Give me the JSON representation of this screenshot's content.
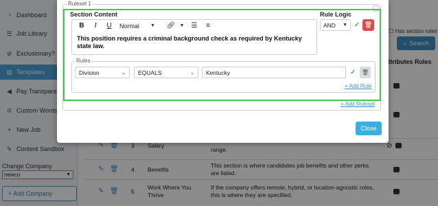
{
  "sidebar": {
    "items": [
      {
        "label": "Dashboard",
        "icon": "speedometer-icon"
      },
      {
        "label": "Job Library",
        "icon": "list-icon"
      },
      {
        "label": "Exclusionary?",
        "icon": "ban-icon"
      },
      {
        "label": "Templates",
        "icon": "document-icon"
      },
      {
        "label": "Pay Transparen",
        "icon": "megaphone-icon"
      },
      {
        "label": "Custom Words",
        "icon": "trophy-icon"
      },
      {
        "label": "New Job",
        "icon": "plus-icon"
      },
      {
        "label": "Content Sandbox",
        "icon": "pencil-icon"
      }
    ],
    "change_company_label": "Change Company",
    "company_value": "newco",
    "add_company_label": "+ Add Company"
  },
  "background": {
    "has_rules_label": "Has section rules",
    "search_label": "Search",
    "columns": [
      "Attributes",
      "Rules"
    ],
    "rows": [
      {
        "num": "3",
        "name": "Salary",
        "content": "range."
      },
      {
        "num": "4",
        "name": "Benefits",
        "content": "This section is where candidates job benefits and other perks are listed."
      },
      {
        "num": "5",
        "name": "Work Where You Thrive",
        "content": "If the company offers remote, hybrid, or location-agnostic roles, this is where they are specified."
      }
    ]
  },
  "modal": {
    "ruleset_label": "Ruleset 1",
    "section_content_title": "Section Content",
    "rule_logic_title": "Rule Logic",
    "toolbar": {
      "bold": "B",
      "italic": "I",
      "underline": "U",
      "format_value": "Normal"
    },
    "editor_text": "This position requires a criminal background check as required by Kentucky state law.",
    "rule_logic_value": "AND",
    "rules_label": "Rules",
    "rule": {
      "field": "Division",
      "operator": "EQUALS",
      "value": "Kentucky"
    },
    "add_rule_link": "+ Add Rule",
    "add_ruleset_link": "+ Add Ruleset",
    "close_label": "Close"
  },
  "colors": {
    "accent": "#4aa3d8",
    "highlight_border": "#3fcc3f",
    "delete_red": "#e24a4a",
    "check_green": "#3fb24a"
  }
}
